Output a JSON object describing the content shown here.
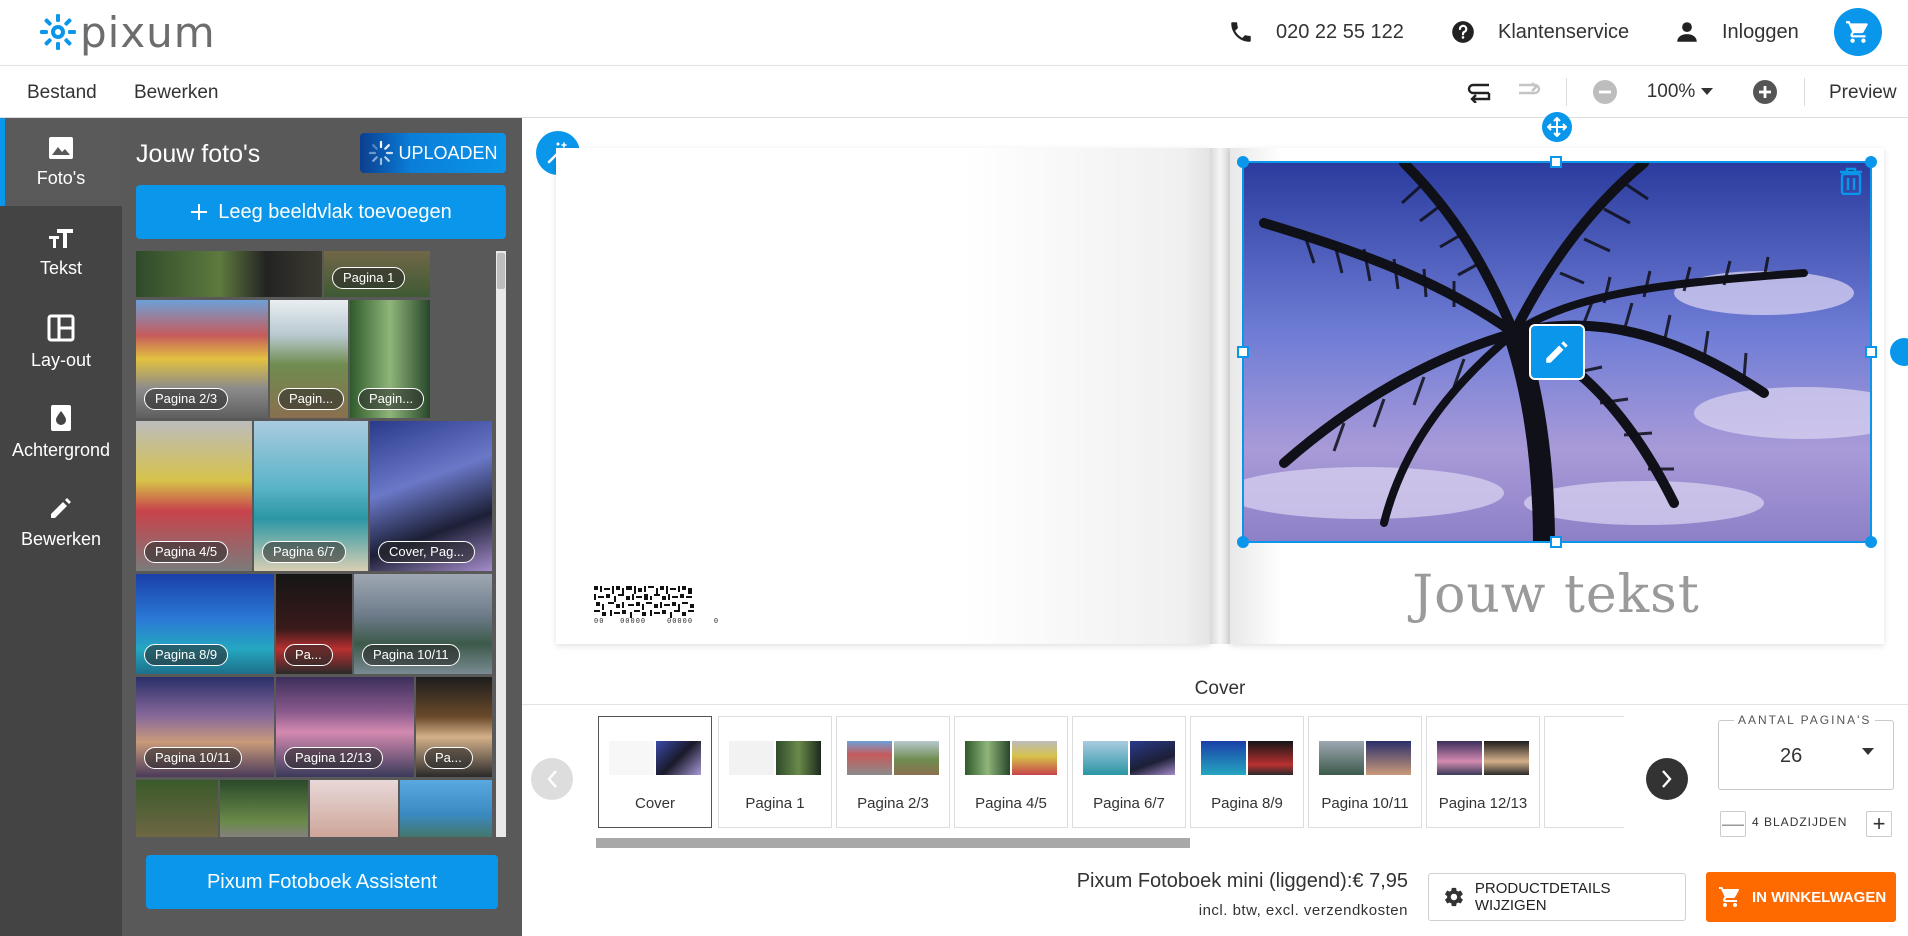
{
  "header": {
    "logo_text": "pixum",
    "phone": "020 22 55 122",
    "service": "Klantenservice",
    "login": "Inloggen"
  },
  "menu": {
    "file": "Bestand",
    "edit": "Bewerken",
    "zoom": "100%",
    "preview": "Preview"
  },
  "rail": [
    {
      "label": "Foto's",
      "icon": "image-icon",
      "active": true
    },
    {
      "label": "Tekst",
      "icon": "text-size-icon"
    },
    {
      "label": "Lay-out",
      "icon": "layout-icon"
    },
    {
      "label": "Achtergrond",
      "icon": "paint-drop-icon"
    },
    {
      "label": "Bewerken",
      "icon": "pencil-icon"
    }
  ],
  "panel": {
    "title": "Jouw foto's",
    "upload": "UPLOADEN",
    "add_empty": "Leeg beeldvlak toevoegen",
    "assistant": "Pixum Fotoboek Assistent",
    "photos": [
      {
        "label": "Pagina 1"
      },
      {
        "label": "Pagina 2/3"
      },
      {
        "label": "Pagin..."
      },
      {
        "label": "Pagin..."
      },
      {
        "label": "Pagina 4/5"
      },
      {
        "label": "Pagina 6/7"
      },
      {
        "label": "Cover, Pag..."
      },
      {
        "label": "Pagina 8/9"
      },
      {
        "label": "Pa..."
      },
      {
        "label": "Pagina 10/11"
      },
      {
        "label": "Pagina 10/11"
      },
      {
        "label": "Pagina 12/13"
      },
      {
        "label": "Pa..."
      }
    ]
  },
  "canvas": {
    "barcode_digits": "00   00000    00000    0",
    "cover_text": "Jouw tekst",
    "page_caption": "Cover"
  },
  "strip": {
    "pages": [
      "Cover",
      "Pagina 1",
      "Pagina 2/3",
      "Pagina 4/5",
      "Pagina 6/7",
      "Pagina 8/9",
      "Pagina 10/11",
      "Pagina 12/13"
    ]
  },
  "pages_control": {
    "legend": "AANTAL PAGINA'S",
    "value": "26",
    "step_label": "4 BLADZIJDEN",
    "minus": "—",
    "plus": "+"
  },
  "order": {
    "product": "Pixum Fotoboek mini (liggend):",
    "price": "€ 7,95",
    "price_note": "incl. btw, excl. verzendkosten",
    "product_details": "PRODUCTDETAILS WIJZIGEN",
    "add_to_cart": "IN WINKELWAGEN"
  },
  "colors": {
    "accent": "#0a96ea",
    "cart_orange": "#ff6a00",
    "rail_bg": "#444444",
    "panel_bg": "#595959"
  }
}
